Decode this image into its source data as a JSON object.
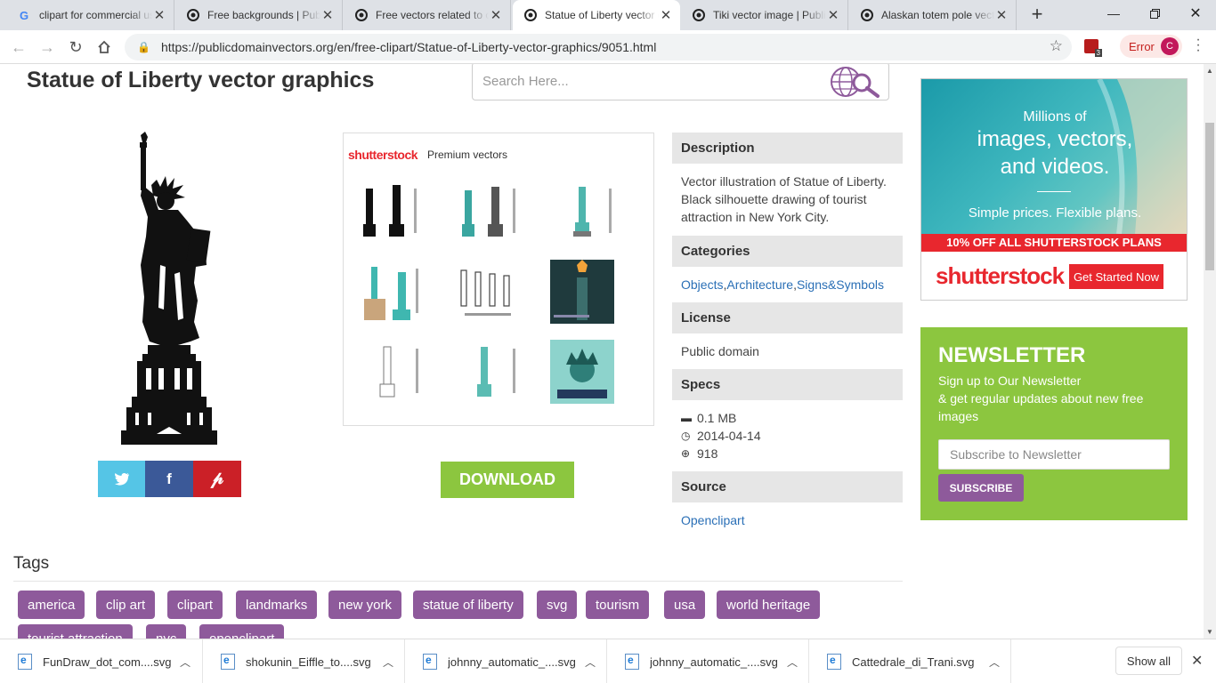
{
  "browser": {
    "tabs": [
      {
        "title": "clipart for commercial use",
        "favicon": "google-g-icon",
        "active": false
      },
      {
        "title": "Free backgrounds | Public",
        "favicon": "pdv-logo-icon",
        "active": false
      },
      {
        "title": "Free vectors related to clipart",
        "favicon": "pdv-logo-icon",
        "active": false
      },
      {
        "title": "Statue of Liberty vector graphics",
        "favicon": "pdv-logo-icon",
        "active": true
      },
      {
        "title": "Tiki vector image | Public",
        "favicon": "pdv-logo-icon",
        "active": false
      },
      {
        "title": "Alaskan totem pole vector",
        "favicon": "pdv-logo-icon",
        "active": false
      }
    ],
    "url": "https://publicdomainvectors.org/en/free-clipart/Statue-of-Liberty-vector-graphics/9051.html",
    "extension_badge": "3",
    "error_label": "Error",
    "profile_initial": "C"
  },
  "page": {
    "title": "Statue of Liberty vector graphics",
    "search_placeholder": "Search Here...",
    "shutterstock": {
      "logo": "shutterstock",
      "label": "Premium vectors"
    },
    "download_label": "DOWNLOAD",
    "social": [
      "twitter-icon",
      "facebook-icon",
      "pinterest-icon"
    ],
    "info": {
      "description_heading": "Description",
      "description": "Vector illustration of Statue of Liberty. Black silhouette drawing of tourist attraction in New York City.",
      "categories_heading": "Categories",
      "categories": [
        "Objects",
        "Architecture",
        "Signs&Symbols"
      ],
      "license_heading": "License",
      "license": "Public domain",
      "specs_heading": "Specs",
      "size": "0.1 MB",
      "date": "2014-04-14",
      "downloads": "918",
      "source_heading": "Source",
      "source": "Openclipart"
    },
    "ad": {
      "line1": "Millions of",
      "line2a": "images, vectors,",
      "line2b": "and videos.",
      "line3": "Simple prices. Flexible plans.",
      "promo": "10% OFF ALL SHUTTERSTOCK PLANS",
      "logo": "shutterstock",
      "cta": "Get Started Now"
    },
    "newsletter": {
      "heading": "NEWSLETTER",
      "line1": "Sign up to Our Newsletter",
      "line2": "& get regular updates about new free images",
      "placeholder": "Subscribe to Newsletter",
      "button": "SUBSCRIBE"
    },
    "tags_heading": "Tags",
    "tags": [
      "america",
      "clip art",
      "clipart",
      "landmarks",
      "new york",
      "statue of liberty",
      "svg",
      "tourism",
      "usa",
      "world heritage",
      "tourist attraction",
      "nyc",
      "openclipart"
    ]
  },
  "downloads": {
    "items": [
      "FunDraw_dot_com....svg",
      "shokunin_Eiffle_to....svg",
      "johnny_automatic_....svg",
      "johnny_automatic_....svg",
      "Cattedrale_di_Trani.svg"
    ],
    "show_all": "Show all"
  },
  "colors": {
    "accent_green": "#8cc63f",
    "tag_purple": "#8e5a9b",
    "twitter": "#55c5e6",
    "facebook": "#3b5998",
    "pinterest": "#cb2027",
    "shutterstock_red": "#e8272e"
  }
}
